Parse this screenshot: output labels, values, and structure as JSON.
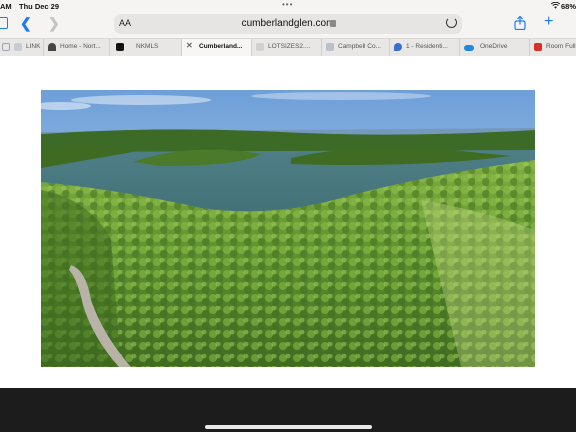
{
  "status": {
    "time": "AM",
    "date": "Thu Dec 29",
    "dots": "•••",
    "battery": "68%"
  },
  "nav": {
    "reader_label": "AA",
    "url": "cumberlandglen.com"
  },
  "tabs": [
    {
      "label": "LINK",
      "favicon_color": "#9aa4b2"
    },
    {
      "label": "Home - Nort...",
      "favicon_color": "#333333"
    },
    {
      "label": "NKMLS",
      "favicon_color": "#111111"
    },
    {
      "label": "Cumberland...",
      "favicon_color": "#666666"
    },
    {
      "label": "LOTSIZES2....",
      "favicon_color": "#c9c9c9"
    },
    {
      "label": "Campbell Co...",
      "favicon_color": "#9aa4b2"
    },
    {
      "label": "1 - Residenti...",
      "favicon_color": "#3a6fd6"
    },
    {
      "label": "OneDrive",
      "favicon_color": "#1e88e5"
    },
    {
      "label": "Room Full",
      "favicon_color": "#d93025"
    }
  ],
  "colors": {
    "accent": "#1a7cf5",
    "chrome_bg": "#f5f4f2",
    "bottom_bar": "#1c1c1c"
  },
  "hero": {
    "alt": "Aerial view of a lake surrounded by green forested hills"
  }
}
